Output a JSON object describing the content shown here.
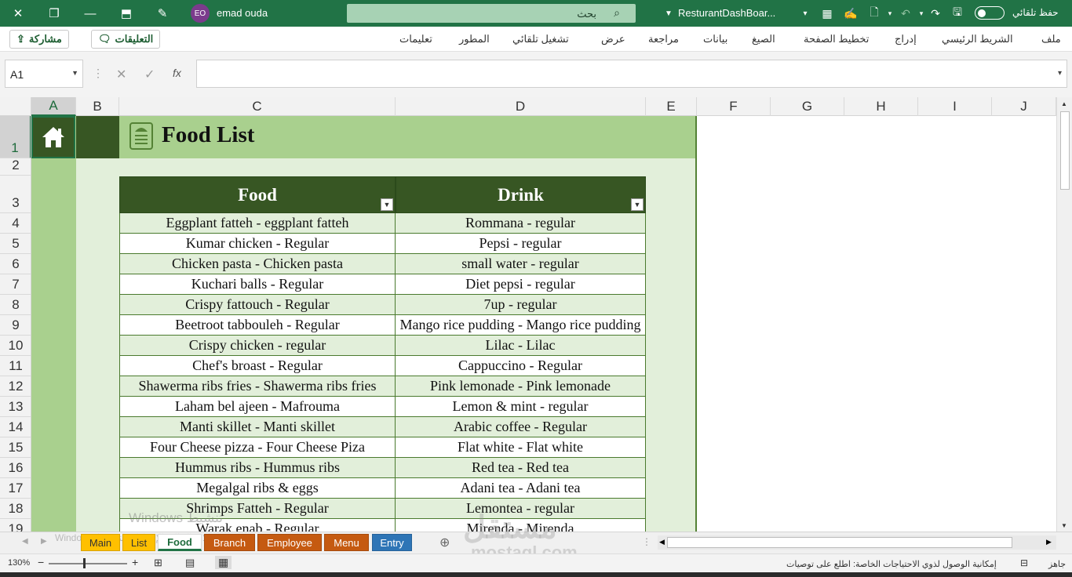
{
  "titlebar": {
    "filename": "ResturantDashBoar...",
    "user_name": "emad ouda",
    "user_initials": "EO",
    "search_placeholder": "بحث",
    "autosave_label": "حفظ تلقائي",
    "bg_color": "#217346"
  },
  "ribbon": {
    "tabs": [
      "ملف",
      "الشريط الرئيسي",
      "إدراج",
      "تخطيط الصفحة",
      "الصيغ",
      "بيانات",
      "مراجعة",
      "عرض",
      "تشغيل تلقائي",
      "المطور",
      "تعليمات"
    ],
    "comments_label": "التعليقات",
    "share_label": "مشاركة"
  },
  "formula_bar": {
    "name_box": "A1",
    "fx_label": "fx",
    "formula": ""
  },
  "grid": {
    "columns": [
      "A",
      "B",
      "C",
      "D",
      "E",
      "F",
      "G",
      "H",
      "I",
      "J"
    ],
    "rows": [
      "1",
      "2",
      "3",
      "4",
      "5",
      "6",
      "7",
      "8",
      "9",
      "10",
      "11",
      "12",
      "13",
      "14",
      "15",
      "16",
      "17",
      "18",
      "19"
    ],
    "selected_cell": "A1"
  },
  "sheet": {
    "title": "Food List",
    "headers": {
      "food": "Food",
      "drink": "Drink"
    },
    "rows": [
      {
        "food": "Eggplant fatteh - eggplant fatteh",
        "drink": "Rommana - regular"
      },
      {
        "food": "Kumar chicken - Regular",
        "drink": "Pepsi - regular"
      },
      {
        "food": "Chicken pasta - Chicken pasta",
        "drink": "small water - regular"
      },
      {
        "food": "Kuchari balls - Regular",
        "drink": "Diet pepsi - regular"
      },
      {
        "food": "Crispy fattouch - Regular",
        "drink": "7up - regular"
      },
      {
        "food": "Beetroot tabbouleh - Regular",
        "drink": "Mango rice pudding - Mango rice pudding"
      },
      {
        "food": "Crispy chicken - regular",
        "drink": "Lilac - Lilac"
      },
      {
        "food": "Chef's broast - Regular",
        "drink": "Cappuccino - Regular"
      },
      {
        "food": "Shawerma ribs fries - Shawerma ribs fries",
        "drink": "Pink lemonade - Pink lemonade"
      },
      {
        "food": "Laham bel ajeen - Mafrouma",
        "drink": "Lemon & mint - regular"
      },
      {
        "food": "Manti skillet - Manti skillet",
        "drink": "Arabic coffee - Regular"
      },
      {
        "food": "Four Cheese pizza - Four Cheese Piza",
        "drink": "Flat white - Flat white"
      },
      {
        "food": "Hummus ribs - Hummus ribs",
        "drink": "Red tea - Red tea"
      },
      {
        "food": "Megalgal ribs & eggs",
        "drink": "Adani tea - Adani tea"
      },
      {
        "food": "Shrimps Fatteh - Regular",
        "drink": "Lemontea - regular"
      },
      {
        "food": "Warak enab - Regular",
        "drink": "Mirenda - Mirenda"
      }
    ],
    "colors": {
      "dark_green": "#375623",
      "light_green": "#a9d08e",
      "band_green": "#e2efda"
    }
  },
  "sheet_tabs": [
    {
      "label": "Main",
      "color": "#ffc000",
      "text": "#333333"
    },
    {
      "label": "List",
      "color": "#ffc000",
      "text": "#333333"
    },
    {
      "label": "Food",
      "color": "#70ad47",
      "text": "#1e6b3c",
      "active": true
    },
    {
      "label": "Branch",
      "color": "#c55a11",
      "text": "#ffffff"
    },
    {
      "label": "Employee",
      "color": "#c55a11",
      "text": "#ffffff"
    },
    {
      "label": "Menu",
      "color": "#c55a11",
      "text": "#ffffff"
    },
    {
      "label": "Entry",
      "color": "#2e75b6",
      "text": "#ffffff"
    }
  ],
  "status": {
    "ready": "جاهز",
    "accessibility": "إمكانية الوصول لذوي الاحتياجات الخاصة: اطلع على توصيات",
    "zoom": "130%"
  },
  "watermark": {
    "windows_line1": "Windows تنشيط",
    "windows_line2": "Windows الانتقال إلى الإعدادات لتنشيط",
    "site_ar": "مستقل",
    "site": "mostaql.com"
  }
}
